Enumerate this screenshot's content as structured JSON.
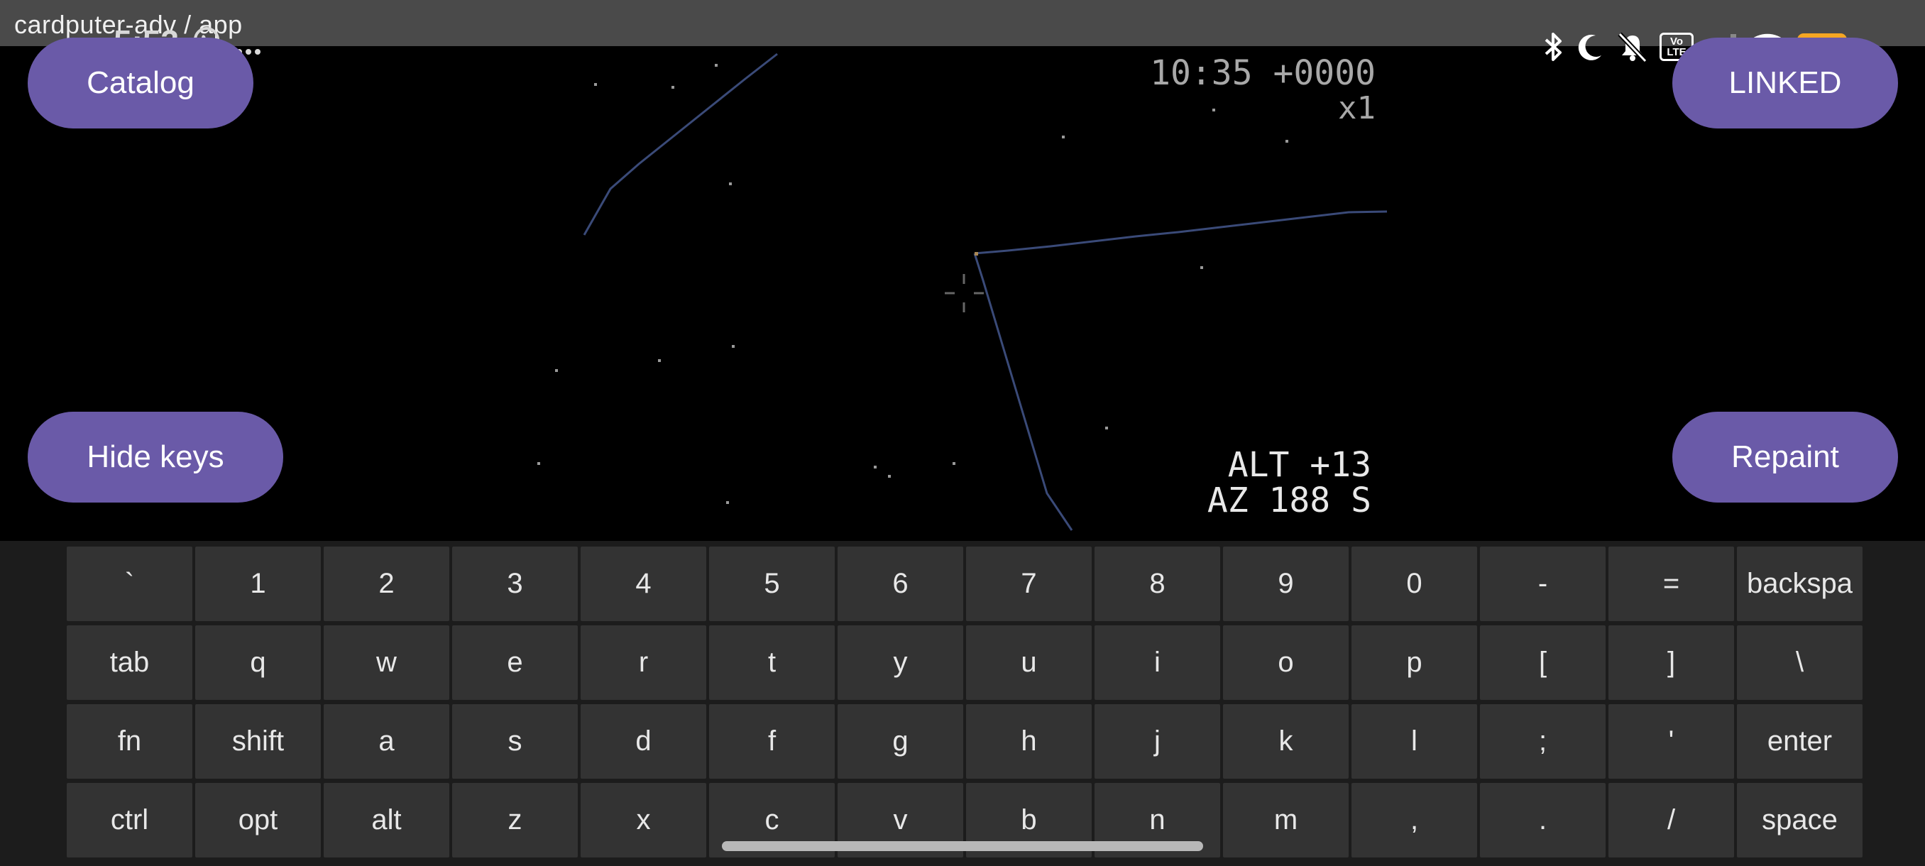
{
  "window": {
    "title": "cardputer-adv / app"
  },
  "status_bar": {
    "time": "5:53",
    "icons": [
      "whatsapp-icon",
      "more-dots-icon",
      "bluetooth-icon",
      "moon-icon",
      "muted-bell-icon",
      "volte-icon",
      "signal-icon",
      "wifi-icon",
      "battery-icon"
    ],
    "volte_label": "Vo\nLTE",
    "battery_level": "37",
    "battery_color": "#f5a623"
  },
  "sky": {
    "time": "10:35 +0000",
    "speed": "x1",
    "alt": "ALT +13",
    "az": "AZ 188 S",
    "line_color": "#3a4a78",
    "star_color": "#9a9a9a"
  },
  "buttons": {
    "catalog": "Catalog",
    "linked": "LINKED",
    "hide_keys": "Hide keys",
    "repaint": "Repaint",
    "accent": "#6a5aa8"
  },
  "keyboard": {
    "rows": [
      [
        "`",
        "1",
        "2",
        "3",
        "4",
        "5",
        "6",
        "7",
        "8",
        "9",
        "0",
        "-",
        "=",
        "backspa"
      ],
      [
        "tab",
        "q",
        "w",
        "e",
        "r",
        "t",
        "y",
        "u",
        "i",
        "o",
        "p",
        "[",
        "]",
        "\\"
      ],
      [
        "fn",
        "shift",
        "a",
        "s",
        "d",
        "f",
        "g",
        "h",
        "j",
        "k",
        "l",
        ";",
        "'",
        "enter"
      ],
      [
        "ctrl",
        "opt",
        "alt",
        "z",
        "x",
        "c",
        "v",
        "b",
        "n",
        "m",
        ",",
        ".",
        "/",
        "space"
      ]
    ]
  }
}
